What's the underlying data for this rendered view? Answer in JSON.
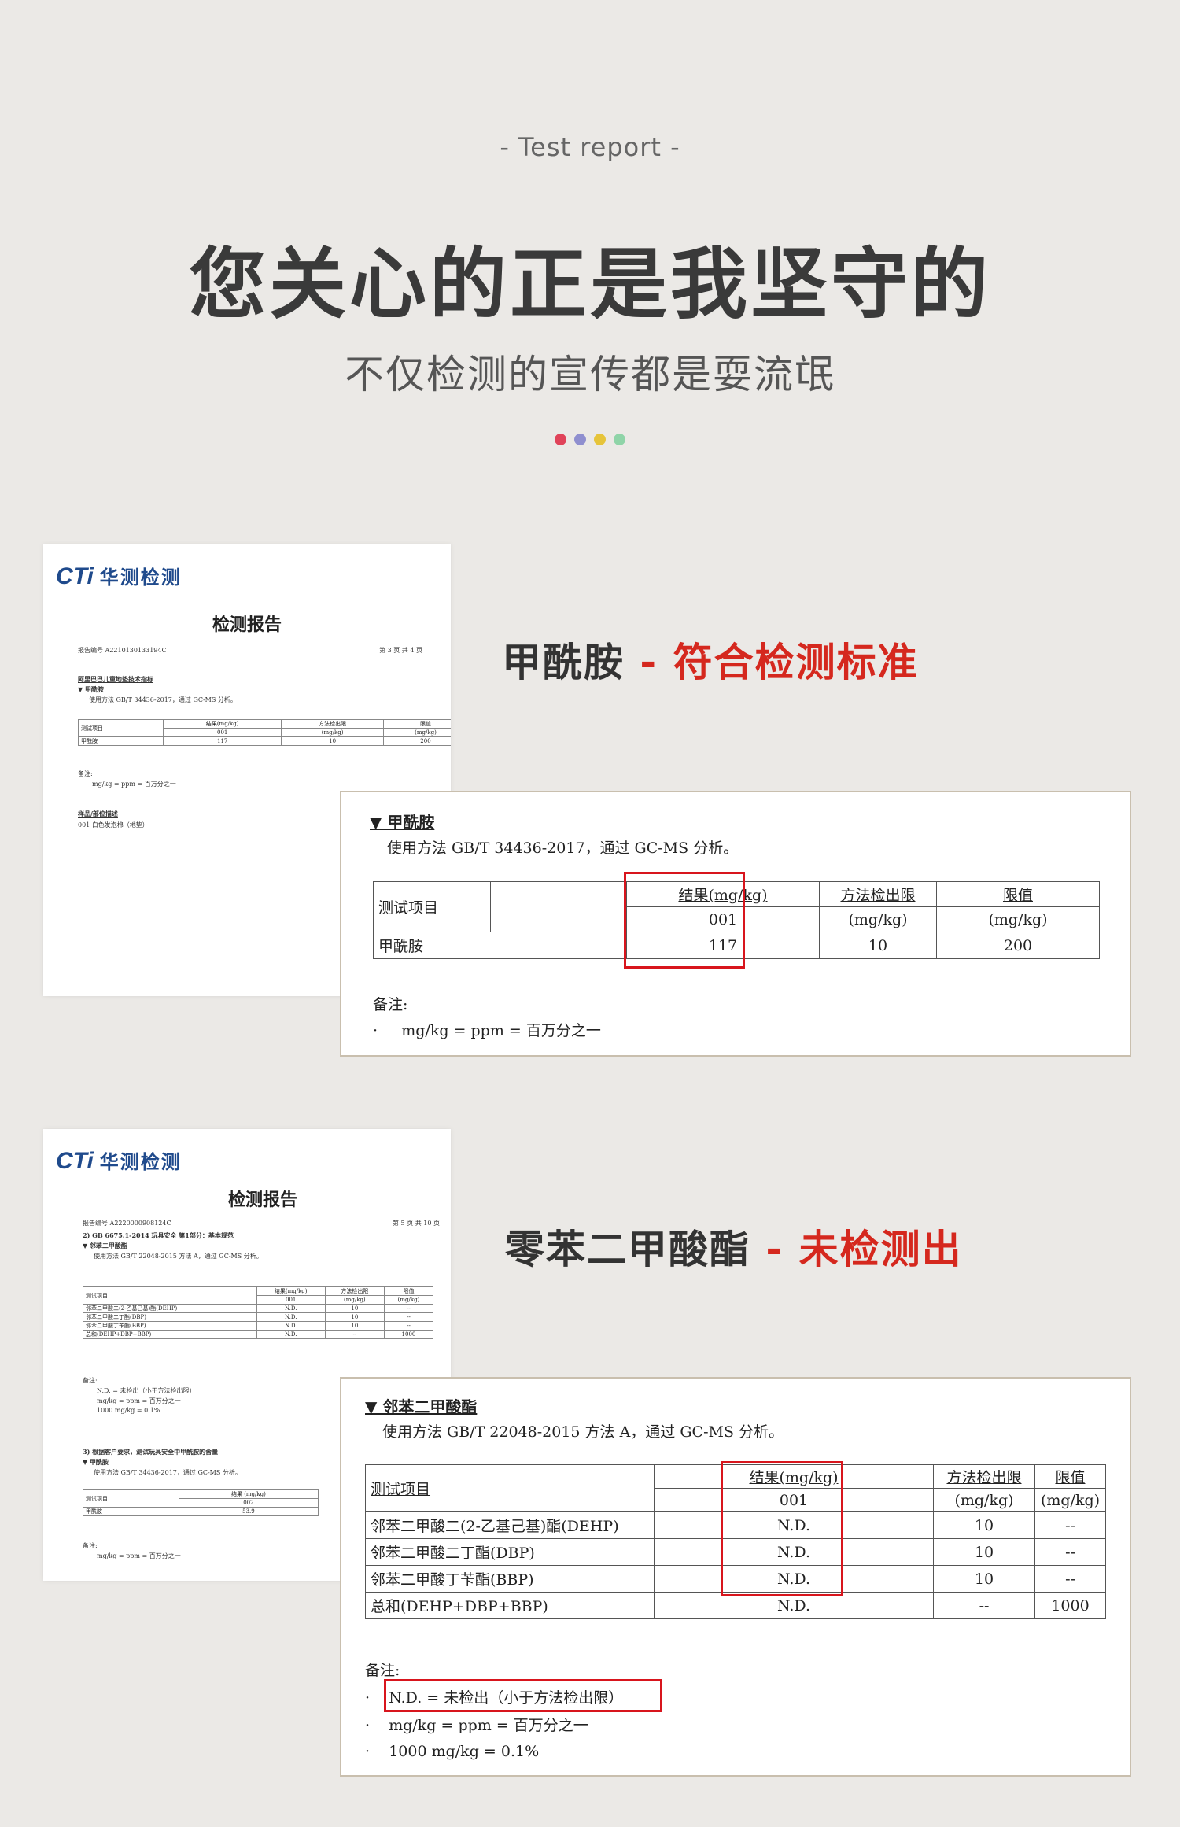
{
  "header": {
    "eyebrow": "- Test report -",
    "headline": "您关心的正是我坚守的",
    "subline": "不仅检测的宣传都是耍流氓",
    "dots": [
      "#e04359",
      "#8f8fcf",
      "#e6c43a",
      "#8fd4a8"
    ]
  },
  "section1": {
    "title_main": "甲酰胺",
    "title_result": " - 符合检测标准",
    "thumb": {
      "logo_mark": "CTi",
      "logo_name": "华测检测",
      "title": "检测报告",
      "report_no": "报告编号  A2210130133194C",
      "page": "第 3 页 共 4 页",
      "line1": "阿里巴巴儿童地垫技术指标",
      "line2": "▼ 甲酰胺",
      "line3": "使用方法 GB/T 34436-2017，通过 GC-MS 分析。",
      "table": [
        [
          "测试项目",
          "结果(mg/kg)",
          "方法检出限",
          "限值"
        ],
        [
          "",
          "001",
          "(mg/kg)",
          "(mg/kg)"
        ],
        [
          "甲酰胺",
          "117",
          "10",
          "200"
        ]
      ],
      "note1": "备注:",
      "note2": "mg/kg = ppm = 百万分之一",
      "sample1": "样品/部位描述",
      "sample2": "001    白色发泡棉（地垫）"
    },
    "zoom": {
      "heading": "▼ 甲酰胺",
      "method": "使用方法 GB/T 34436-2017，通过 GC-MS 分析。",
      "col_item": "测试项目",
      "col_result": "结果(mg/kg)",
      "col_result_sub": "001",
      "col_mdl": "方法检出限",
      "col_mdl_unit": "(mg/kg)",
      "col_limit": "限值",
      "col_limit_unit": "(mg/kg)",
      "rows": [
        {
          "item": "甲酰胺",
          "result": "117",
          "mdl": "10",
          "limit": "200"
        }
      ],
      "note_label": "备注:",
      "notes": [
        "mg/kg = ppm =  百万分之一"
      ]
    }
  },
  "section2": {
    "title_main": "零苯二甲酸酯",
    "title_result": " - 未检测出",
    "thumb": {
      "logo_mark": "CTi",
      "logo_name": "华测检测",
      "title": "检测报告",
      "report_no": "报告编号  A2220000908124C",
      "page": "第 5 页 共 10 页",
      "line1": "2)  GB 6675.1-2014 玩具安全 第1部分：基本规范",
      "line2": "▼ 邻苯二甲酸酯",
      "line3": "使用方法 GB/T 22048-2015 方法 A，通过 GC-MS 分析。",
      "table": [
        [
          "测试项目",
          "结果(mg/kg)",
          "方法检出限",
          "限值"
        ],
        [
          "",
          "001",
          "(mg/kg)",
          "(mg/kg)"
        ],
        [
          "邻苯二甲酸二(2-乙基己基)酯(DEHP)",
          "N.D.",
          "10",
          "--"
        ],
        [
          "邻苯二甲酸二丁酯(DBP)",
          "N.D.",
          "10",
          "--"
        ],
        [
          "邻苯二甲酸丁苄酯(BBP)",
          "N.D.",
          "10",
          "--"
        ],
        [
          "总和(DEHP+DBP+BBP)",
          "N.D.",
          "--",
          "1000"
        ]
      ],
      "note1": "备注:",
      "note2": "N.D. = 未检出（小于方法检出限）",
      "note3": "mg/kg = ppm = 百万分之一",
      "note4": "1000 mg/kg = 0.1%",
      "line4": "3)  根据客户要求，测试玩具安全中甲酰胺的含量",
      "line5": "▼ 甲酰胺",
      "line6": "使用方法 GB/T 34436-2017，通过 GC-MS 分析。",
      "table2": [
        [
          "测试项目",
          "结果 (mg/kg)"
        ],
        [
          "",
          "002"
        ],
        [
          "甲酰胺",
          "53.9"
        ]
      ],
      "note5": "备注:",
      "note6": "mg/kg = ppm = 百万分之一"
    },
    "zoom": {
      "heading": "▼ 邻苯二甲酸酯",
      "method": "使用方法 GB/T 22048-2015  方法 A，通过 GC-MS 分析。",
      "col_item": "测试项目",
      "col_result": "结果(mg/kg)",
      "col_result_sub": "001",
      "col_mdl": "方法检出限",
      "col_mdl_unit": "(mg/kg)",
      "col_limit": "限值",
      "col_limit_unit": "(mg/kg)",
      "rows": [
        {
          "item": "邻苯二甲酸二(2-乙基己基)酯(DEHP)",
          "result": "N.D.",
          "mdl": "10",
          "limit": "--"
        },
        {
          "item": "邻苯二甲酸二丁酯(DBP)",
          "result": "N.D.",
          "mdl": "10",
          "limit": "--"
        },
        {
          "item": "邻苯二甲酸丁苄酯(BBP)",
          "result": "N.D.",
          "mdl": "10",
          "limit": "--"
        },
        {
          "item": "总和(DEHP+DBP+BBP)",
          "result": "N.D.",
          "mdl": "--",
          "limit": "1000"
        }
      ],
      "note_label": "备注:",
      "notes": [
        "N.D. = 未检出（小于方法检出限）",
        "mg/kg = ppm =  百万分之一",
        "1000 mg/kg = 0.1%"
      ]
    }
  }
}
